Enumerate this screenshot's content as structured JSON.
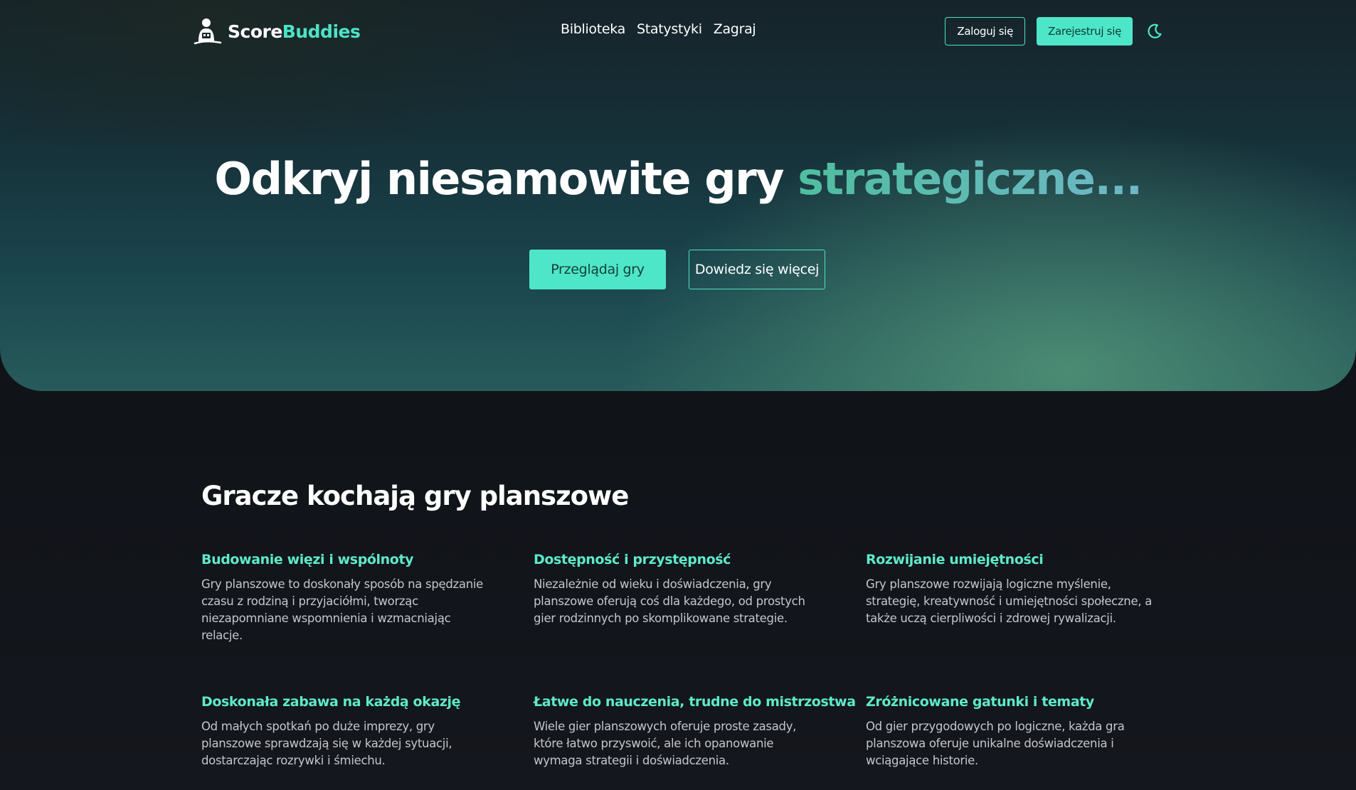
{
  "brand": {
    "name_part1": "Score",
    "name_part2": "Buddies",
    "logo_icon": "person-with-board-icon",
    "accent_color": "#4ee6c8"
  },
  "nav": {
    "links": [
      {
        "label": "Biblioteka"
      },
      {
        "label": "Statystyki"
      },
      {
        "label": "Zagraj"
      }
    ],
    "login_label": "Zaloguj się",
    "register_label": "Zarejestruj się",
    "theme_toggle_icon": "theme-toggle-icon"
  },
  "hero": {
    "headline_plain": "Odkryj niesamowite gry ",
    "headline_highlight": "strategiczne...",
    "primary_button": "Przeglądaj gry",
    "secondary_button": "Dowiedz się więcej"
  },
  "features": {
    "title": "Gracze kochają gry planszowe",
    "items": [
      {
        "title": "Budowanie więzi i wspólnoty",
        "description": "Gry planszowe to doskonały sposób na spędzanie czasu z rodziną i przyjaciółmi, tworząc niezapomniane wspomnienia i wzmacniając relacje."
      },
      {
        "title": "Dostępność i przystępność",
        "description": "Niezależnie od wieku i doświadczenia, gry planszowe oferują coś dla każdego, od prostych gier rodzinnych po skomplikowane strategie."
      },
      {
        "title": "Rozwijanie umiejętności",
        "description": "Gry planszowe rozwijają logiczne myślenie, strategię, kreatywność i umiejętności społeczne, a także uczą cierpliwości i zdrowej rywalizacji."
      },
      {
        "title": "Doskonała zabawa na każdą okazję",
        "description": "Od małych spotkań po duże imprezy, gry planszowe sprawdzają się w każdej sytuacji, dostarczając rozrywki i śmiechu."
      },
      {
        "title": "Łatwe do nauczenia, trudne do mistrzostwa",
        "description": "Wiele gier planszowych oferuje proste zasady, które łatwo przyswoić, ale ich opanowanie wymaga strategii i doświadczenia."
      },
      {
        "title": "Zróżnicowane gatunki i tematy",
        "description": "Od gier przygodowych po logiczne, każda gra planszowa oferuje unikalne doświadczenia i wciągające historie."
      }
    ]
  }
}
